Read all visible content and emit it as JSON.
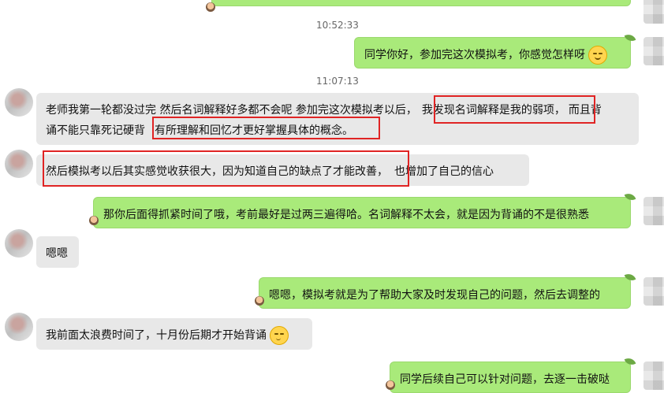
{
  "timestamps": [
    "10:52:33",
    "11:07:13"
  ],
  "messages": [
    {
      "side": "right",
      "text": "同学你好，参加完这次模拟考，你感觉怎样呀",
      "emoji": "smile-emoji"
    },
    {
      "side": "left",
      "line1_a": "老师我第一轮都没过完 然后名词解释好多都不会呢 参加完这次模拟考以后，",
      "line1_hl": "我发现名词解释是我的弱项，",
      "line1_b": "而且背",
      "line2_a": "诵不能只靠死记硬背",
      "line2_hl": "有所理解和回忆才更好掌握具体的概念。"
    },
    {
      "side": "left",
      "hl": "然后模拟考以后其实感觉收获很大，因为知道自己的缺点了才能改善，",
      "rest": "也增加了自己的信心"
    },
    {
      "side": "right",
      "text": "那你后面得抓紧时间了哦，考前最好是过两三遍得哈。名词解释不太会，就是因为背诵的不是很熟悉"
    },
    {
      "side": "left",
      "text": "嗯嗯"
    },
    {
      "side": "right",
      "text": "嗯嗯，模拟考就是为了帮助大家及时发现自己的问题，然后去调整的"
    },
    {
      "side": "left",
      "text": "我前面太浪费时间了，十月份后期才开始背诵",
      "emoji": "smirk-emoji"
    },
    {
      "side": "right",
      "text": "同学后续自己可以针对问题，去逐一击破哒"
    }
  ],
  "colors": {
    "out_bubble": "#a9ea7a",
    "in_bubble": "#e8e8e8",
    "highlight": "#e02424"
  }
}
